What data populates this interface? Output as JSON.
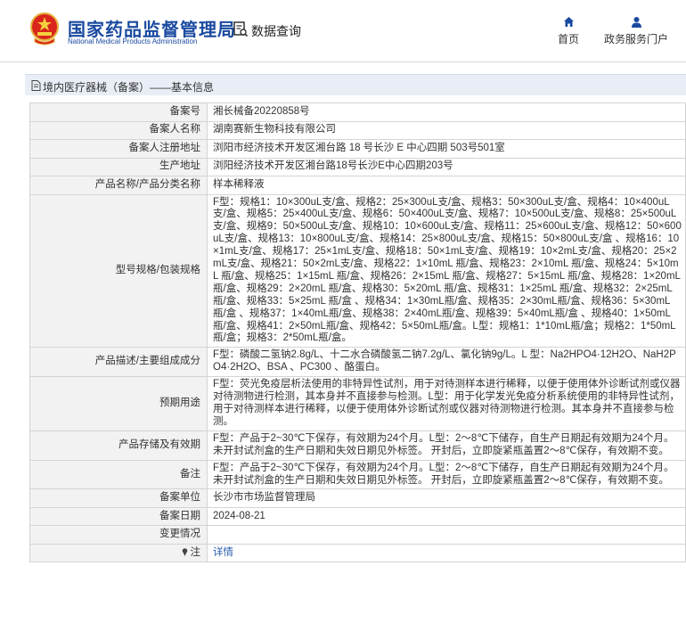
{
  "header": {
    "org_cn": "国家药品监督管理局",
    "org_en": "National Medical Products Administration",
    "query_label": "数据查询",
    "nav": [
      {
        "label": "首页",
        "icon": "home-icon"
      },
      {
        "label": "政务服务门户",
        "icon": "user-icon"
      }
    ]
  },
  "breadcrumb": "境内医疗器械（备案）——基本信息",
  "rows": [
    {
      "label": "备案号",
      "value": "湘长械备20220858号"
    },
    {
      "label": "备案人名称",
      "value": "湖南赛新生物科技有限公司"
    },
    {
      "label": "备案人注册地址",
      "value": "浏阳市经济技术开发区湘台路 18 号长沙 E 中心四期 503号501室"
    },
    {
      "label": "生产地址",
      "value": "浏阳经济技术开发区湘台路18号长沙E中心四期203号"
    },
    {
      "label": "产品名称/产品分类名称",
      "value": "样本稀释液"
    },
    {
      "label": "型号规格/包装规格",
      "value": "F型：规格1：10×300uL支/盒、规格2：25×300uL支/盒、规格3：50×300uL支/盒、规格4：10×400uL支/盒、规格5：25×400uL支/盒、规格6：50×400uL支/盒、规格7：10×500uL支/盒、规格8：25×500uL支/盒、规格9：50×500uL支/盒、规格10：10×600uL支/盒、规格11：25×600uL支/盒、规格12：50×600uL支/盒、规格13：10×800uL支/盒、规格14：25×800uL支/盒、规格15：50×800uL支/盒 、规格16：10×1mL支/盒、规格17：25×1mL支/盒、规格18：50×1mL支/盒、规格19：10×2mL支/盒、规格20：25×2mL支/盒、规格21：50×2mL支/盒、规格22：1×10mL 瓶/盒、规格23：2×10mL 瓶/盒、规格24：5×10mL 瓶/盒、规格25：1×15mL 瓶/盒、规格26：2×15mL 瓶/盒、规格27：5×15mL 瓶/盒、规格28：1×20mL 瓶/盒、规格29：2×20mL 瓶/盒、规格30：5×20mL 瓶/盒、规格31：1×25mL 瓶/盒、规格32：2×25mL 瓶/盒、规格33：5×25mL 瓶/盒 、规格34：1×30mL瓶/盒、规格35：2×30mL瓶/盒、规格36：5×30mL瓶/盒 、规格37：1×40mL瓶/盒、规格38：2×40mL瓶/盒、规格39：5×40mL瓶/盒 、规格40：1×50mL瓶/盒、规格41：2×50mL瓶/盒、规格42：5×50mL瓶/盒。L型：规格1：1*10mL瓶/盒；规格2：1*50mL瓶/盒；规格3：2*50mL瓶/盒。"
    },
    {
      "label": "产品描述/主要组成成分",
      "value": "F型：磷酸二氢钠2.8g/L、十二水合磷酸氢二钠7.2g/L、氯化钠9g/L。L 型：Na2HPO4·12H2O、NaH2PO4·2H2O、BSA 、PC300 、酪蛋白。"
    },
    {
      "label": "预期用途",
      "value": "F型：荧光免疫层析法使用的非特异性试剂，用于对待测样本进行稀释，以便于使用体外诊断试剂或仪器对待测物进行检测，其本身并不直接参与检测。L型：用于化学发光免疫分析系统使用的非特异性试剂，用于对待测样本进行稀释，以便于使用体外诊断试剂或仪器对待测物进行检测。其本身并不直接参与检测。"
    },
    {
      "label": "产品存储及有效期",
      "value": "F型：产品于2~30℃下保存，有效期为24个月。L型：2～8℃下储存，自生产日期起有效期为24个月。未开封试剂盒的生产日期和失效日期见外标签。 开封后，立即旋紧瓶盖置2～8℃保存，有效期不变。"
    },
    {
      "label": "备注",
      "value": "F型：产品于2~30℃下保存，有效期为24个月。L型：2～8℃下储存，自生产日期起有效期为24个月。未开封试剂盒的生产日期和失效日期见外标签。 开封后，立即旋紧瓶盖置2～8℃保存，有效期不变。"
    },
    {
      "label": "备案单位",
      "value": "长沙市市场监督管理局"
    },
    {
      "label": "备案日期",
      "value": "2024-08-21"
    },
    {
      "label": "变更情况",
      "value": ""
    }
  ],
  "footer_row": {
    "label": "注",
    "link": "详情"
  }
}
